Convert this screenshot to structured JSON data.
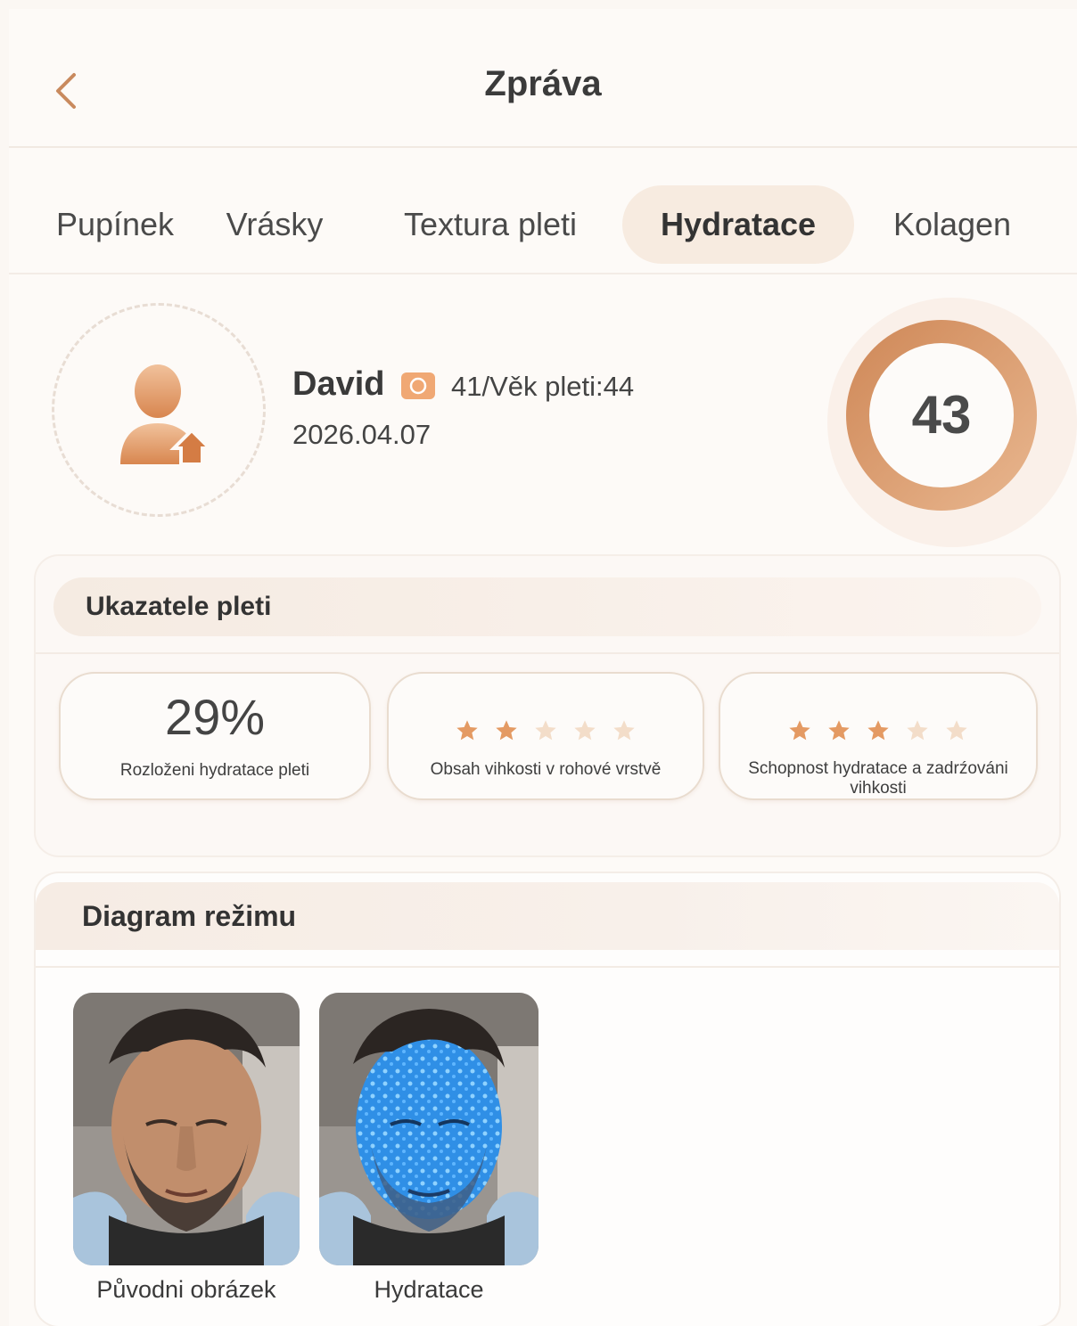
{
  "header": {
    "title": "Zpráva"
  },
  "tabs": [
    {
      "label": "Pupínek",
      "active": false
    },
    {
      "label": "Vrásky",
      "active": false
    },
    {
      "label": "Textura pleti",
      "active": false
    },
    {
      "label": "Hydratace",
      "active": true
    },
    {
      "label": "Kolagen",
      "active": false
    }
  ],
  "profile": {
    "name": "David",
    "age_info": "41/Věk pleti:44",
    "date": "2026.04.07",
    "score": "43",
    "score_fraction": 0.43
  },
  "indicators": {
    "title": "Ukazatele pleti",
    "items": [
      {
        "value": "29%",
        "label": "Rozloženi hydratace pleti"
      },
      {
        "stars": 2,
        "max_stars": 5,
        "label": "Obsah vihkosti v rohové vrstvě"
      },
      {
        "stars": 3,
        "max_stars": 5,
        "label": "Schopnost hydratace a zadrźováni vihkosti"
      }
    ]
  },
  "diagram": {
    "title": "Diagram režimu",
    "images": [
      {
        "caption": "Původni obrázek"
      },
      {
        "caption": "Hydratace"
      }
    ]
  },
  "colors": {
    "accent": "#d9956a",
    "accent_light": "#f7ebe0",
    "star_filled": "#e49a63",
    "star_empty": "#f3ddc9",
    "hydration_blue": "#2f8fe6"
  }
}
